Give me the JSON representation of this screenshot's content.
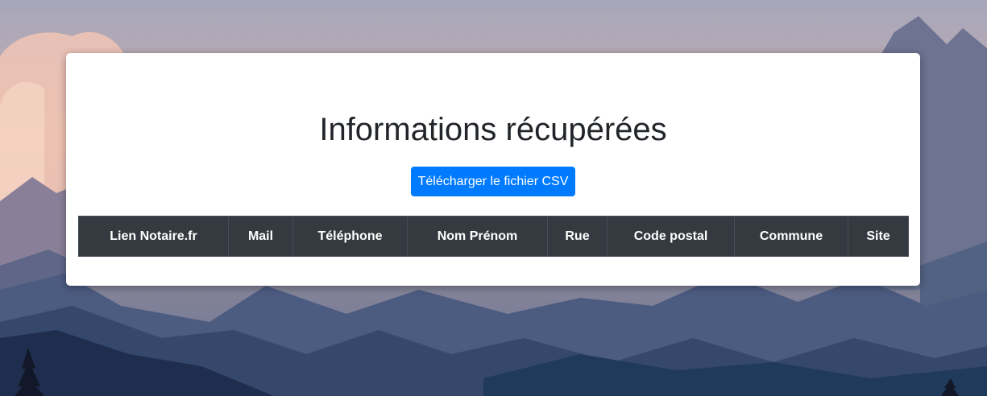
{
  "page": {
    "title": "Informations récupérées",
    "download_button": "Télécharger le fichier CSV"
  },
  "table": {
    "columns": [
      "Lien Notaire.fr",
      "Mail",
      "Téléphone",
      "Nom Prénom",
      "Rue",
      "Code postal",
      "Commune",
      "Site"
    ],
    "rows": []
  },
  "colors": {
    "button": "#007bff",
    "table_header": "#343a40",
    "card": "#ffffff",
    "title": "#212529"
  },
  "icons": [
    "mountain-landscape-background"
  ]
}
